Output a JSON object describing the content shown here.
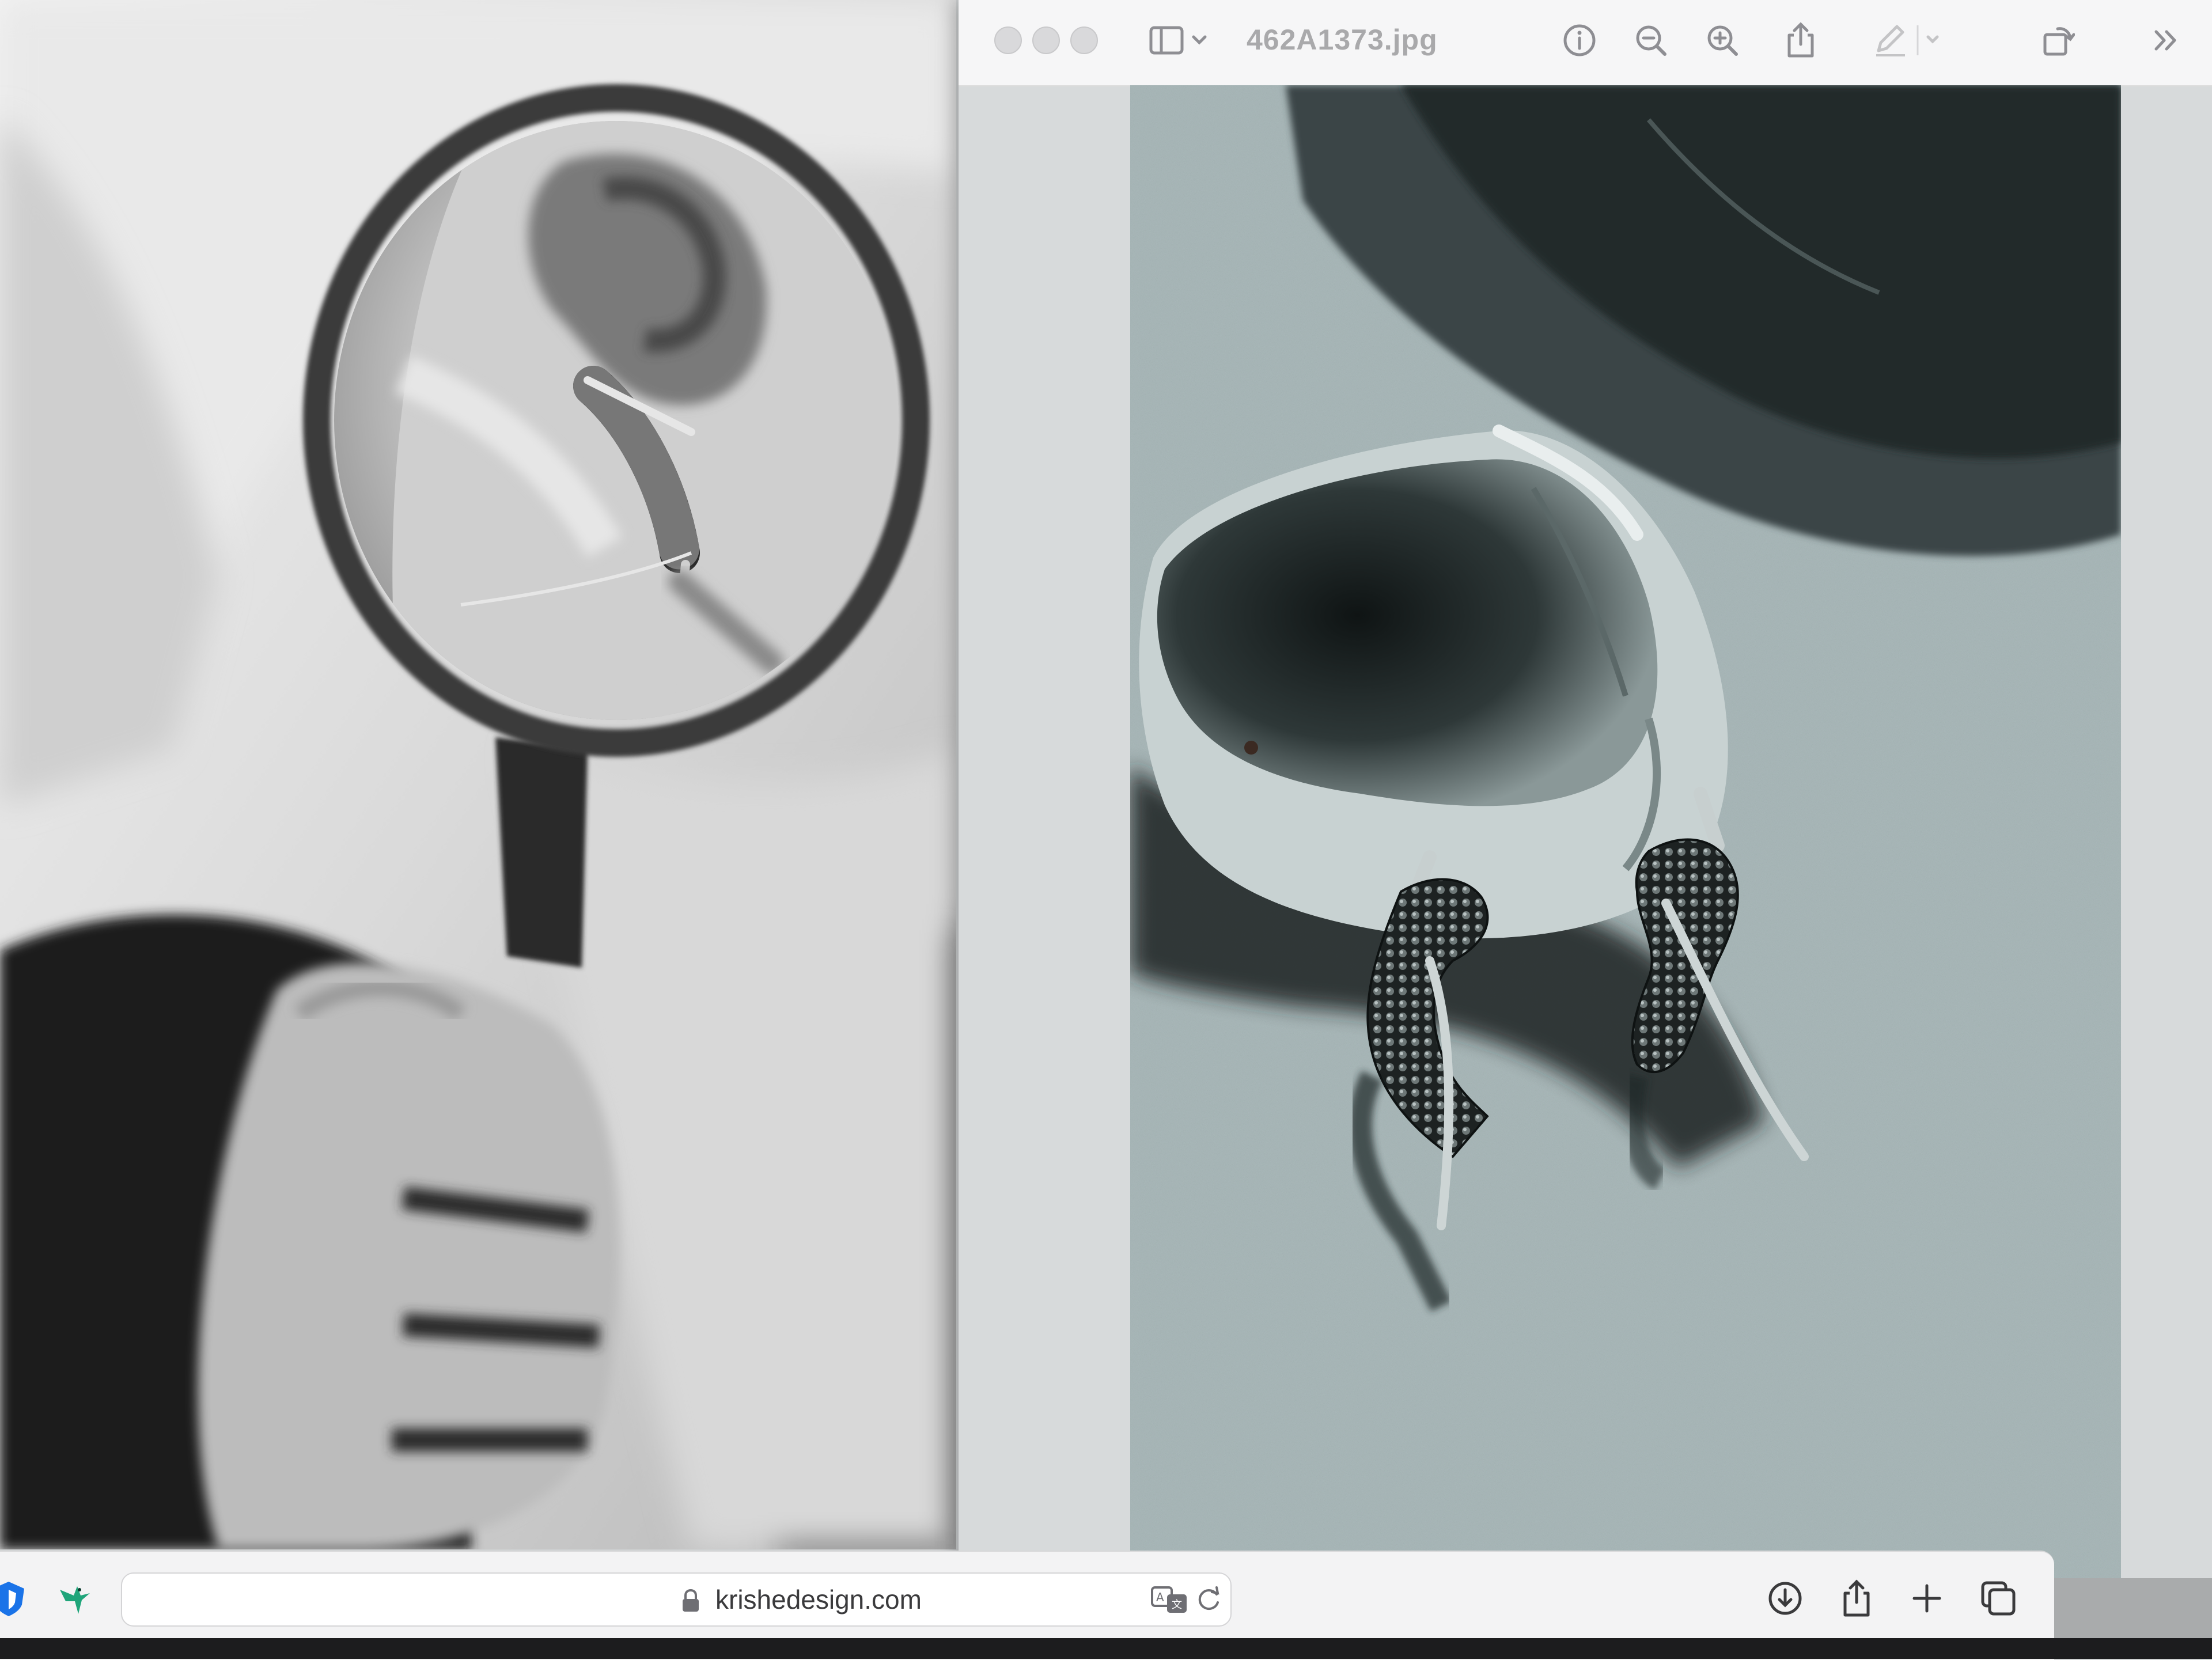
{
  "preview": {
    "title": "462A1373.jpg",
    "toolbar": {
      "sidebar_icon": "sidebar-icon",
      "info_icon": "info-icon",
      "zoom_out_icon": "zoom-out-icon",
      "zoom_in_icon": "zoom-in-icon",
      "share_icon": "share-icon",
      "markup_icon": "markup-pencil-icon",
      "rotate_icon": "rotate-icon",
      "more_icon": "chevron-double-right-icon"
    }
  },
  "browser": {
    "url": "krishedesign.com",
    "icons": [
      "shield-extension-icon",
      "hummingbird-extension-icon",
      "translate-icon",
      "reload-icon",
      "download-icon",
      "share-icon",
      "new-tab-plus-icon",
      "tabs-overview-icon"
    ]
  },
  "colors": {
    "toolbar_bg": "#f6f6f7",
    "icon_gray": "#8e8e93",
    "url_bar_bg": "#ffffff",
    "photo_tint": "#a9b8b9"
  }
}
